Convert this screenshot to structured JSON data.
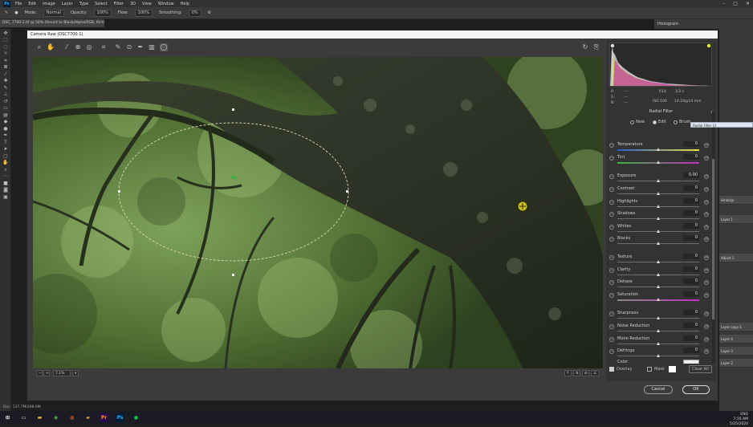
{
  "ps": {
    "logo": "Ps",
    "menus": [
      "File",
      "Edit",
      "Image",
      "Layer",
      "Type",
      "Select",
      "Filter",
      "3D",
      "View",
      "Window",
      "Help"
    ],
    "window_controls": [
      "–",
      "□",
      "✕"
    ],
    "doc_tab": "DSC_7700-2.tif @ 50% (Revert to Black/Alpha/RGB, 8/ctrl)",
    "status": "Doc: 137.7M/288.6M",
    "layers": [
      "Hintergr",
      "Layer 1",
      "Adjust 1",
      "Layer copy 1",
      "Layer 4",
      "Layer 3",
      "Layer 2"
    ],
    "right_panel_title": "Histogram"
  },
  "options_bar": {
    "mode_label": "Mode:",
    "mode_value": "Normal",
    "opacity_label": "Opacity:",
    "opacity_value": "100%",
    "flow_label": "Flow:",
    "flow_value": "100%",
    "smoothing_label": "Smoothing:",
    "smoothing_value": "0%"
  },
  "camera_raw": {
    "title": "Camera Raw (DSC7700-1)",
    "zoom": "7.1%",
    "meta": {
      "r_label": "R:",
      "g_label": "G:",
      "b_label": "B:",
      "dash": "---",
      "aperture": "f/14",
      "shutter": "1/3 s",
      "iso": "ISO 100",
      "lens": "14-24@14 mm"
    },
    "panel_title": "Radial Filter",
    "modes": [
      {
        "label": "New",
        "selected": false
      },
      {
        "label": "Edit",
        "selected": true
      },
      {
        "label": "Brush",
        "selected": false
      }
    ],
    "tooltip": "Radial Filter (J)",
    "sliders": [
      {
        "label": "Temperature",
        "value": "0",
        "position": 0.5
      },
      {
        "label": "Tint",
        "value": "0",
        "position": 0.5
      },
      {
        "label": "Exposure",
        "value": "0.00",
        "position": 0.5
      },
      {
        "label": "Contrast",
        "value": "0",
        "position": 0.5
      },
      {
        "label": "Highlights",
        "value": "0",
        "position": 0.5
      },
      {
        "label": "Shadows",
        "value": "0",
        "position": 0.5
      },
      {
        "label": "Whites",
        "value": "0",
        "position": 0.5
      },
      {
        "label": "Blacks",
        "value": "0",
        "position": 0.5
      },
      {
        "label": "Texture",
        "value": "0",
        "position": 0.5
      },
      {
        "label": "Clarity",
        "value": "0",
        "position": 0.5
      },
      {
        "label": "Dehaze",
        "value": "0",
        "position": 0.5
      },
      {
        "label": "Saturation",
        "value": "0",
        "position": 0.5
      },
      {
        "label": "Sharpness",
        "value": "0",
        "position": 0.5
      },
      {
        "label": "Noise Reduction",
        "value": "0",
        "position": 0.5
      },
      {
        "label": "Moire Reduction",
        "value": "0",
        "position": 0.5
      },
      {
        "label": "Defringe",
        "value": "0",
        "position": 0.5
      }
    ],
    "color_label": "Color",
    "footer": {
      "overlay_label": "Overlay",
      "mask_label": "Mask",
      "clear_all": "Clear All"
    },
    "cancel_label": "Cancel",
    "ok_label": "OK"
  },
  "taskbar": {
    "time": "7:16 AM",
    "date": "5/25/2020",
    "lang": "ENG"
  },
  "colors": {
    "accent": "#31a8ff",
    "overlay_ellipse": "#e0d6b0",
    "pin": "#c8c020"
  }
}
